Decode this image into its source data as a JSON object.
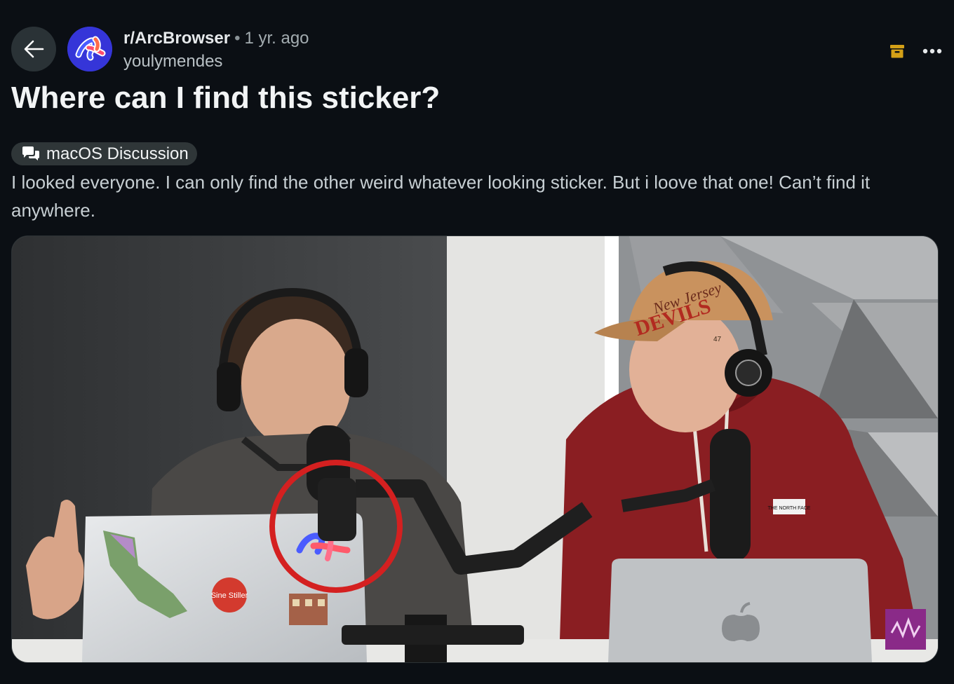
{
  "header": {
    "back_label": "Back",
    "subreddit": "r/ArcBrowser",
    "separator": "•",
    "time": "1 yr. ago",
    "author": "youlymendes"
  },
  "post": {
    "title": "Where can I find this sticker?",
    "flair": "macOS Discussion",
    "body": "I looked everyone. I can only find the other weird whatever looking sticker. But i loove that one! Can’t find it anywhere."
  },
  "image_text": {
    "cap_line1": "New Jersey",
    "cap_line2": "DEVILS",
    "sticker": "Sine Stiller",
    "hoodie_logo": "THE NORTH FACE",
    "cap_brand": "47"
  },
  "colors": {
    "background": "#0b0f14",
    "accent_archive": "#d4a017",
    "circle": "#d42020",
    "avatar_bg": "#3b3bd6"
  },
  "icons": {
    "back": "arrow-left-icon",
    "archive": "archive-icon",
    "more": "more-horizontal-icon",
    "flair": "chat-bubbles-icon"
  }
}
